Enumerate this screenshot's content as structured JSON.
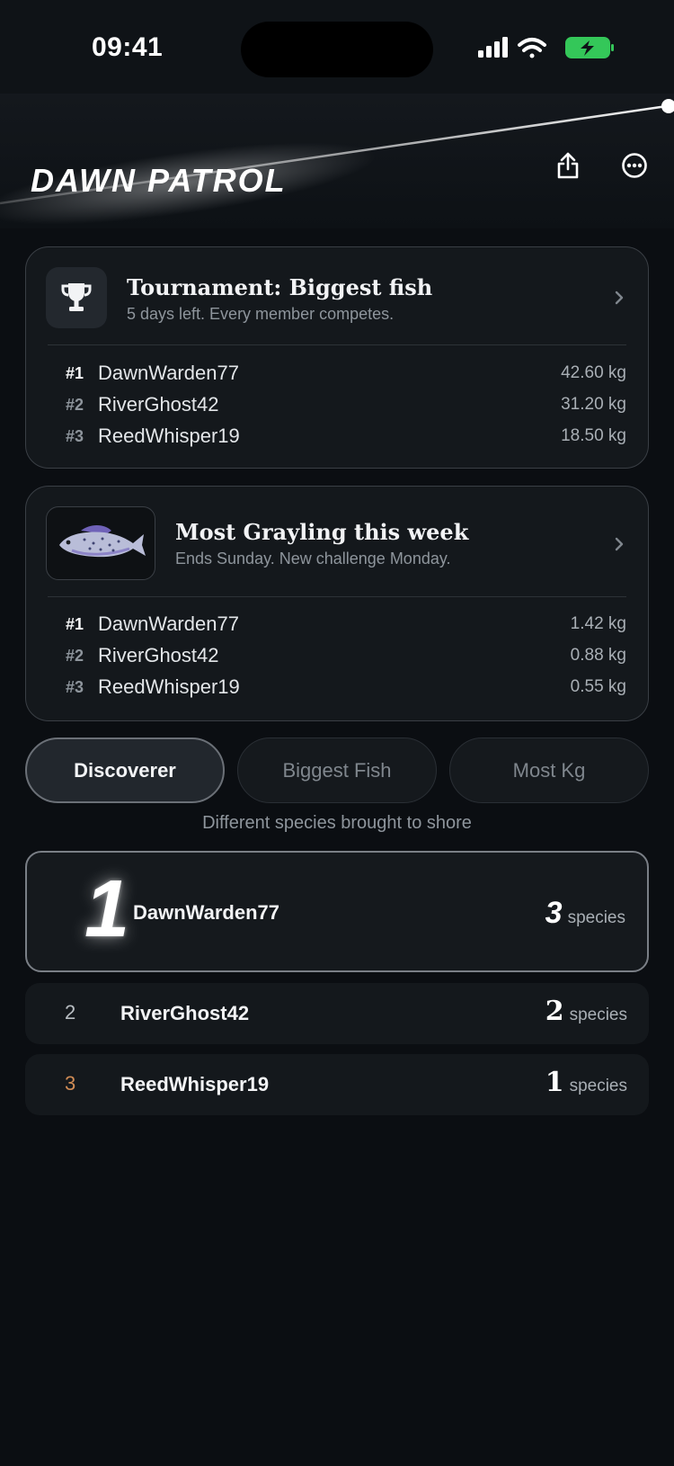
{
  "status": {
    "time": "09:41"
  },
  "header": {
    "title": "DAWN PATROL"
  },
  "tournament": {
    "title": "Tournament: Biggest fish",
    "subtitle": "5 days left. Every member competes.",
    "rows": [
      {
        "rank": "#1",
        "name": "DawnWarden77",
        "value": "42.60 kg"
      },
      {
        "rank": "#2",
        "name": "RiverGhost42",
        "value": "31.20 kg"
      },
      {
        "rank": "#3",
        "name": "ReedWhisper19",
        "value": "18.50 kg"
      }
    ]
  },
  "challenge": {
    "title": "Most Grayling this week",
    "subtitle": "Ends Sunday. New challenge Monday.",
    "rows": [
      {
        "rank": "#1",
        "name": "DawnWarden77",
        "value": "1.42 kg"
      },
      {
        "rank": "#2",
        "name": "RiverGhost42",
        "value": "0.88 kg"
      },
      {
        "rank": "#3",
        "name": "ReedWhisper19",
        "value": "0.55 kg"
      }
    ]
  },
  "segments": {
    "items": [
      "Discoverer",
      "Biggest Fish",
      "Most Kg"
    ],
    "selected": "Discoverer",
    "caption": "Different species brought to shore"
  },
  "leaderboard": [
    {
      "rank": "1",
      "name": "DawnWarden77",
      "count": "3",
      "unit": "species"
    },
    {
      "rank": "2",
      "name": "RiverGhost42",
      "count": "2",
      "unit": "species"
    },
    {
      "rank": "3",
      "name": "ReedWhisper19",
      "count": "1",
      "unit": "species"
    }
  ],
  "icons": {
    "share": "share-icon",
    "more": "more-icon",
    "trophy": "trophy-icon",
    "fish": "grayling-fish-icon",
    "chevron": "chevron-right-icon"
  },
  "colors": {
    "accent": "#f2f3f5",
    "bronze": "#d18c55",
    "battery": "#34c759"
  }
}
